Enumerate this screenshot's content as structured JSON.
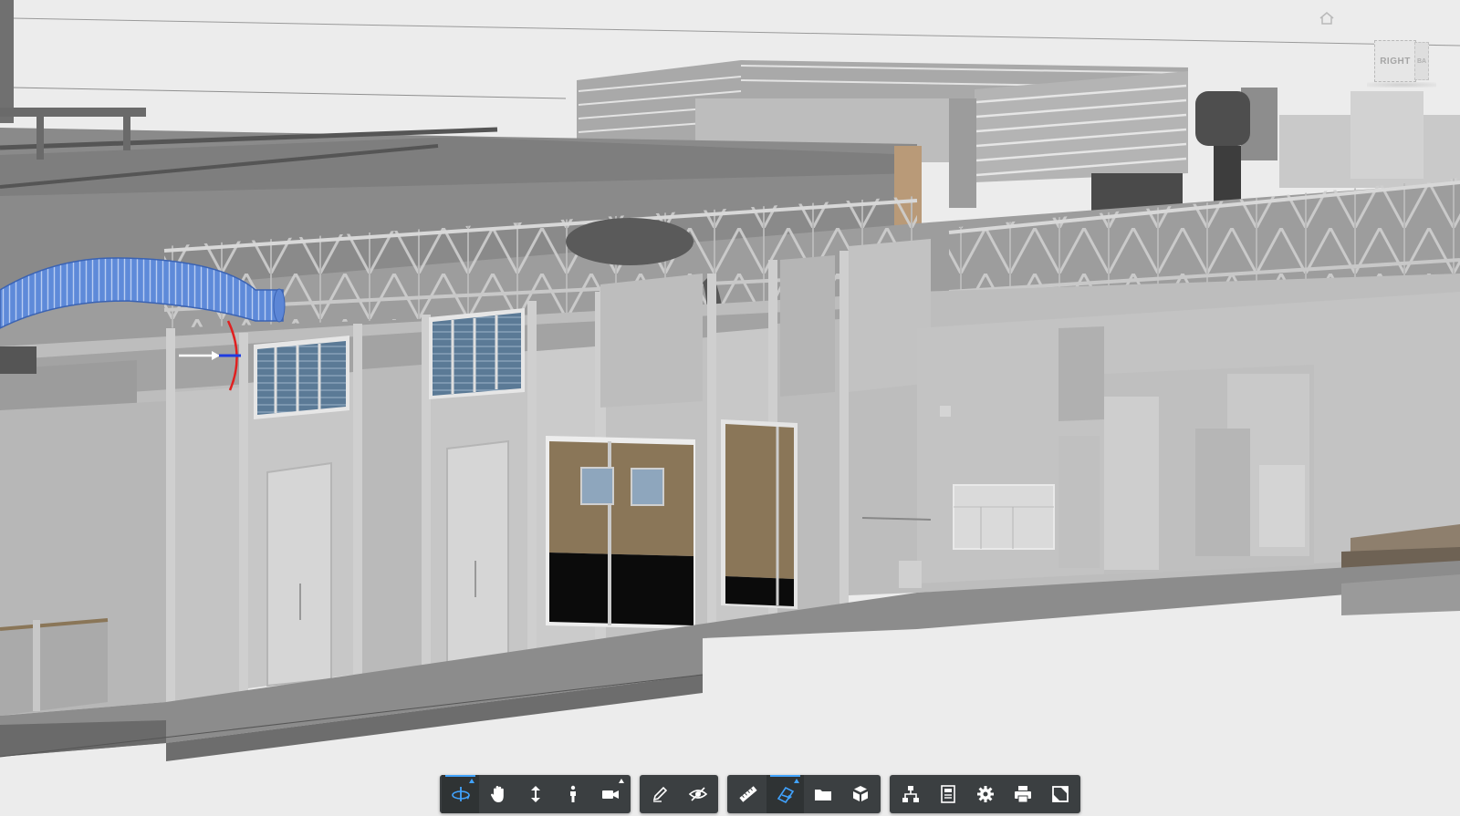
{
  "viewer": {
    "viewcube": {
      "face_label": "RIGHT",
      "side_label": "BA"
    },
    "home_icon": "home-icon"
  },
  "toolbar": {
    "groups": [
      {
        "name": "navigation",
        "tools": [
          {
            "icon": "orbit-icon",
            "active": true,
            "has_submenu": true
          },
          {
            "icon": "pan-hand-icon",
            "active": false,
            "has_submenu": false
          },
          {
            "icon": "dolly-icon",
            "active": false,
            "has_submenu": false
          },
          {
            "icon": "first-person-icon",
            "active": false,
            "has_submenu": false
          },
          {
            "icon": "camera-icon",
            "active": false,
            "has_submenu": true
          }
        ]
      },
      {
        "name": "markup",
        "tools": [
          {
            "icon": "markup-pencil-icon",
            "active": false,
            "has_submenu": false
          },
          {
            "icon": "hide-eye-icon",
            "active": false,
            "has_submenu": false
          }
        ]
      },
      {
        "name": "analysis",
        "tools": [
          {
            "icon": "measure-ruler-icon",
            "active": false,
            "has_submenu": false
          },
          {
            "icon": "section-analysis-icon",
            "active": true,
            "has_submenu": true
          },
          {
            "icon": "folder-icon",
            "active": false,
            "has_submenu": false
          },
          {
            "icon": "explode-cube-icon",
            "active": false,
            "has_submenu": false
          }
        ]
      },
      {
        "name": "settings",
        "tools": [
          {
            "icon": "model-browser-icon",
            "active": false,
            "has_submenu": false
          },
          {
            "icon": "properties-icon",
            "active": false,
            "has_submenu": false
          },
          {
            "icon": "settings-gear-icon",
            "active": false,
            "has_submenu": false
          },
          {
            "icon": "print-icon",
            "active": false,
            "has_submenu": false
          },
          {
            "icon": "fullscreen-icon",
            "active": false,
            "has_submenu": false
          }
        ]
      }
    ]
  },
  "colors": {
    "accent": "#41a3ff",
    "toolbar_bg": "#3b3f41",
    "selected_duct": "#6c94df",
    "door_wood": "#8a7658",
    "window_glass": "#6f8ca6",
    "background": "#ececec"
  }
}
